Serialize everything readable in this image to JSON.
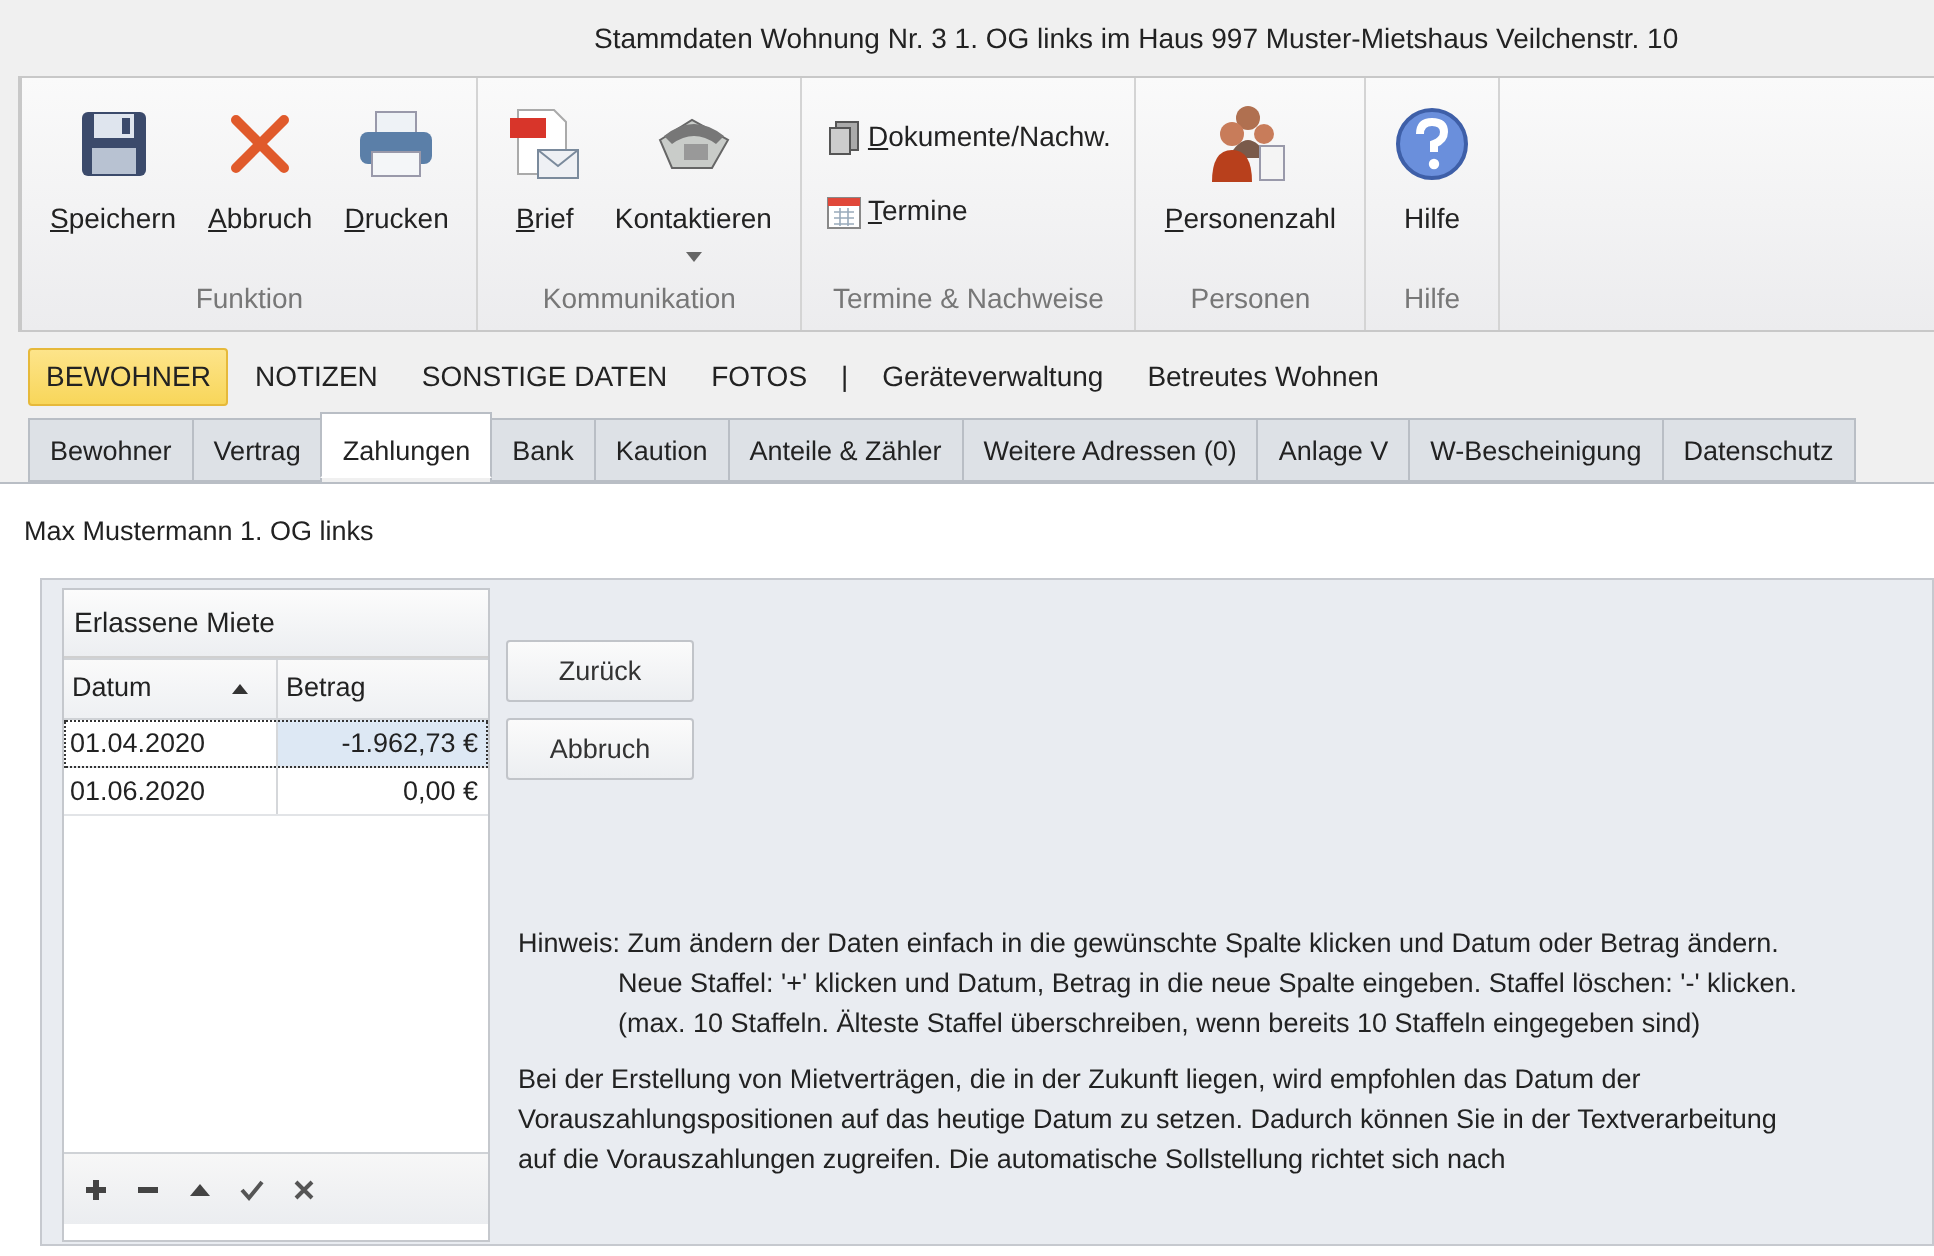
{
  "window": {
    "title": "Stammdaten Wohnung Nr. 3 1. OG links im Haus 997  Muster-Mietshaus Veilchenstr. 10"
  },
  "ribbon": {
    "groups": [
      {
        "label": "Funktion",
        "buttons": [
          {
            "label": "Speichern",
            "kind": "large",
            "access_key": true
          },
          {
            "label": "Abbruch",
            "kind": "large",
            "access_key": true
          },
          {
            "label": "Drucken",
            "kind": "large",
            "access_key": true
          }
        ]
      },
      {
        "label": "Kommunikation",
        "buttons": [
          {
            "label": "Brief",
            "kind": "large",
            "access_key": true
          },
          {
            "label": "Kontaktieren",
            "kind": "large",
            "access_key": false,
            "dropdown": true
          }
        ]
      },
      {
        "label": "Termine & Nachweise",
        "buttons": [
          {
            "label": "Dokumente/Nachw.",
            "kind": "small",
            "access_key": true
          },
          {
            "label": "Termine",
            "kind": "small",
            "access_key": true
          }
        ]
      },
      {
        "label": "Personen",
        "buttons": [
          {
            "label": "Personenzahl",
            "kind": "large",
            "access_key": true
          }
        ]
      },
      {
        "label": "Hilfe",
        "buttons": [
          {
            "label": "Hilfe",
            "kind": "large",
            "access_key": false
          }
        ]
      }
    ]
  },
  "nav": [
    {
      "label": "BEWOHNER",
      "kind": "category",
      "selected": true
    },
    {
      "label": "NOTIZEN",
      "kind": "category",
      "selected": false
    },
    {
      "label": "SONSTIGE DATEN",
      "kind": "category",
      "selected": false
    },
    {
      "label": "FOTOS",
      "kind": "category",
      "selected": false
    },
    {
      "label": "|",
      "kind": "separator"
    },
    {
      "label": "Geräteverwaltung",
      "kind": "link",
      "selected": false
    },
    {
      "label": "Betreutes Wohnen",
      "kind": "link",
      "selected": false
    }
  ],
  "tabs": [
    {
      "label": "Bewohner",
      "selected": false
    },
    {
      "label": "Vertrag",
      "selected": false
    },
    {
      "label": "Zahlungen",
      "selected": true
    },
    {
      "label": "Bank",
      "selected": false
    },
    {
      "label": "Kaution",
      "selected": false
    },
    {
      "label": "Anteile & Zähler",
      "selected": false
    },
    {
      "label": "Weitere Adressen (0)",
      "selected": false
    },
    {
      "label": "Anlage V",
      "selected": false
    },
    {
      "label": "W-Bescheinigung",
      "selected": false
    },
    {
      "label": "Datenschutz",
      "selected": false
    }
  ],
  "tenant_line": "Max Mustermann 1. OG links",
  "grid": {
    "title": "Erlassene Miete",
    "columns": [
      {
        "label": "Datum",
        "sorted": true
      },
      {
        "label": "Betrag",
        "sorted": false
      }
    ],
    "rows": [
      {
        "datum": "01.04.2020",
        "betrag": "-1.962,73  €",
        "selected": true
      },
      {
        "datum": "01.06.2020",
        "betrag": "0,00 €",
        "selected": false
      }
    ]
  },
  "buttons": [
    "Zurück",
    "Abbruch"
  ],
  "hint_lines": [
    "Hinweis: Zum ändern der Daten einfach in die gewünschte Spalte klicken und Datum oder Betrag ändern.",
    "Neue Staffel: '+' klicken und Datum, Betrag in die neue Spalte eingeben. Staffel löschen: '-' klicken.",
    "(max. 10 Staffeln. Älteste Staffel überschreiben, wenn bereits 10 Staffeln eingegeben sind)"
  ],
  "info": "Bei der Erstellung von Mietverträgen, die in der Zukunft liegen, wird empfohlen das Datum der Vorauszahlungspositionen auf das heutige Datum zu setzen. Dadurch können Sie in der Textverarbeitung auf die Vorauszahlungen zugreifen. Die automatische Sollstellung richtet sich nach"
}
